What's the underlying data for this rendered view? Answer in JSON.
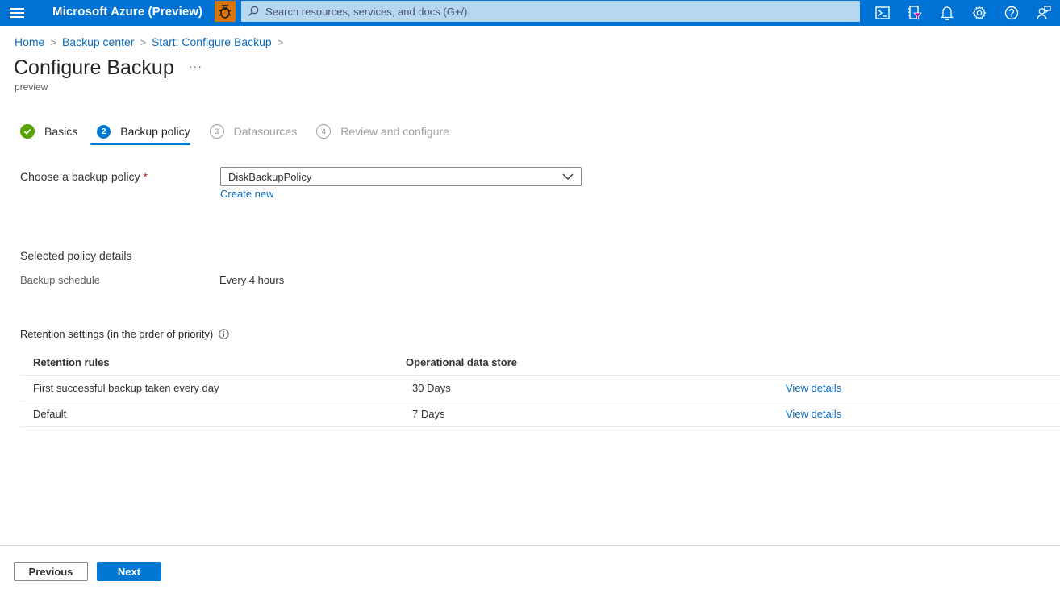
{
  "topbar": {
    "brand": "Microsoft Azure (Preview)",
    "search_placeholder": "Search resources, services, and docs (G+/)",
    "icons": [
      "menu-icon",
      "bug-icon",
      "search-icon",
      "cloud-shell-icon",
      "directory-filter-icon",
      "notifications-icon",
      "settings-icon",
      "help-icon",
      "feedback-icon"
    ],
    "colors": {
      "bar": "#0072d3",
      "search_bg": "#b7d6f1",
      "bug_bg": "#d97406"
    }
  },
  "breadcrumb": {
    "items": [
      "Home",
      "Backup center",
      "Start: Configure Backup"
    ],
    "separator": ">"
  },
  "page": {
    "title": "Configure Backup",
    "more": "···",
    "subtitle": "preview"
  },
  "steps": [
    {
      "number": "✓",
      "label": "Basics",
      "state": "done"
    },
    {
      "number": "2",
      "label": "Backup policy",
      "state": "active"
    },
    {
      "number": "3",
      "label": "Datasources",
      "state": "pending"
    },
    {
      "number": "4",
      "label": "Review and configure",
      "state": "pending"
    }
  ],
  "form": {
    "policy_label": "Choose a backup policy",
    "required_mark": "*",
    "policy_value": "DiskBackupPolicy",
    "create_new": "Create new"
  },
  "policy_details": {
    "title": "Selected policy details",
    "schedule_label": "Backup schedule",
    "schedule_value": "Every 4 hours"
  },
  "retention": {
    "title": "Retention settings (in the order of priority)",
    "columns": [
      "Retention rules",
      "Operational data store",
      ""
    ],
    "rows": [
      {
        "rule": "First successful backup taken every day",
        "store": "30 Days",
        "action": "View details"
      },
      {
        "rule": "Default",
        "store": "7 Days",
        "action": "View details"
      }
    ]
  },
  "footer": {
    "previous": "Previous",
    "next": "Next"
  },
  "colors": {
    "accent": "#0078d4",
    "link": "#0f6cbd",
    "success": "#57a300",
    "required": "#a4262c"
  }
}
